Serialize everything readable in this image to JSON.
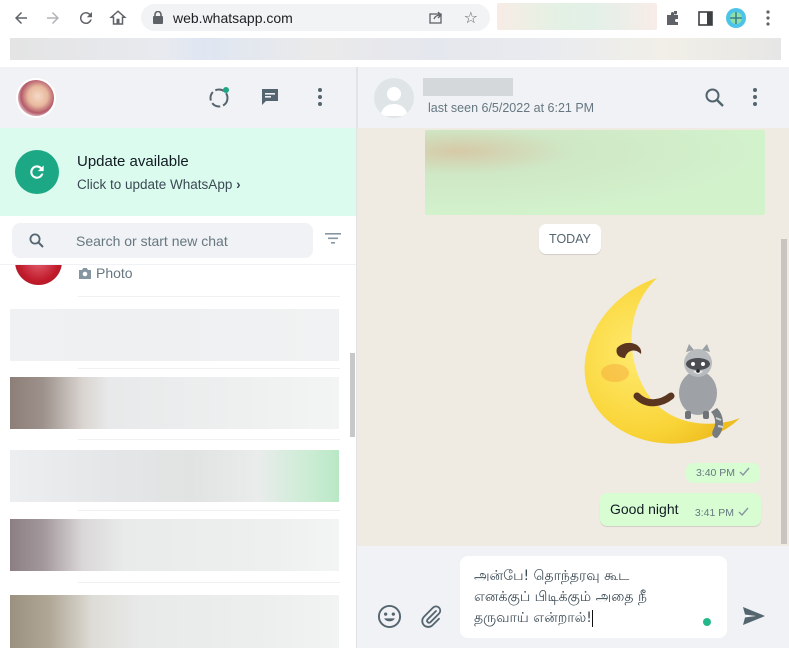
{
  "browser": {
    "url": "web.whatsapp.com",
    "icons": [
      "back-icon",
      "forward-icon",
      "reload-icon",
      "home-icon",
      "lock-icon",
      "share-icon",
      "star-icon",
      "extensions-icon",
      "side-panel-icon",
      "profile-icon",
      "menu-icon"
    ]
  },
  "sidebar": {
    "header_icons": [
      "status-icon",
      "new-chat-icon",
      "menu-icon"
    ],
    "update_banner": {
      "title": "Update available",
      "subtitle": "Click to update WhatsApp",
      "chevron": "›"
    },
    "search": {
      "placeholder": "Search or start new chat",
      "value": ""
    },
    "chats": [
      {
        "preview": "Photo",
        "preview_icon": "camera-icon"
      },
      {
        "preview": ""
      },
      {
        "preview": ""
      },
      {
        "preview": ""
      },
      {
        "preview": ""
      },
      {
        "preview": ""
      }
    ]
  },
  "conversation": {
    "header": {
      "last_seen": "last seen 6/5/2022 at 6:21 PM"
    },
    "date_divider": "TODAY",
    "messages": [
      {
        "type": "image",
        "direction": "outgoing"
      },
      {
        "type": "sticker",
        "direction": "outgoing",
        "description": "crescent moon with raccoon",
        "time": "3:40 PM",
        "status": "sent"
      },
      {
        "type": "text",
        "direction": "outgoing",
        "text": "Good night",
        "time": "3:41 PM",
        "status": "sent"
      }
    ],
    "composer": {
      "value": "அன்பே! தொந்தரவு கூட\nஎனக்குப் பிடிக்கும் அதை நீ\nதருவாய் என்றால்!"
    }
  },
  "colors": {
    "accent": "#1da885",
    "banner_bg": "#dcfbef",
    "outgoing_bubble": "#d9fdd3",
    "chat_bg": "#efeae2",
    "header_bg": "#f0f2f5"
  }
}
